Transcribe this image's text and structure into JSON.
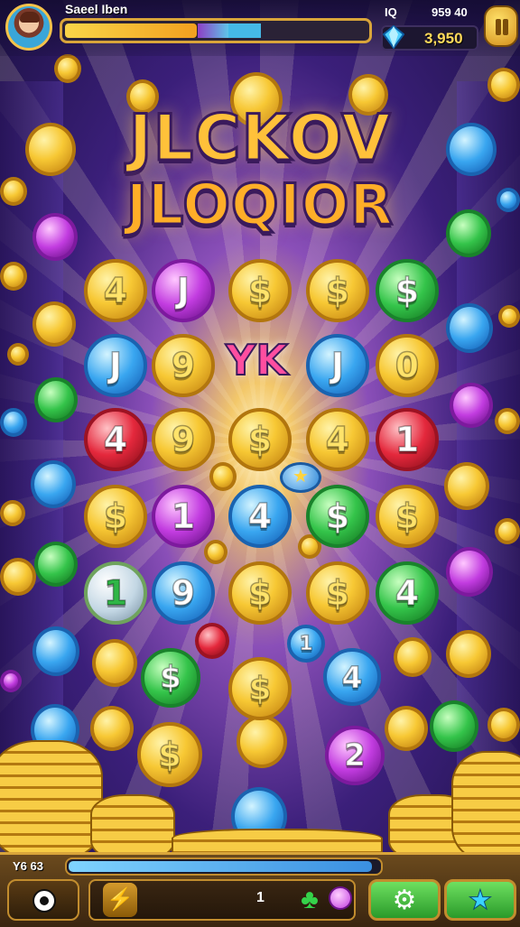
{
  "header": {
    "player_name": "Saeel Iben",
    "xp_fraction": 0.43,
    "score_label": "IQ",
    "score_value": "959 40",
    "gem_value": "3,950",
    "avatar_label": "",
    "pause_icon": "pause-icon"
  },
  "title": {
    "line1": "JLCKOV",
    "line2": "JLOQIOR"
  },
  "board": {
    "rows": [
      [
        {
          "text": "4",
          "color": "gold"
        },
        {
          "text": "J",
          "color": "purple"
        },
        {
          "text": "$",
          "color": "gold"
        },
        {
          "text": "$",
          "color": "gold"
        },
        {
          "text": "$",
          "color": "green"
        }
      ],
      [
        {
          "text": "J",
          "color": "blue"
        },
        {
          "text": "9",
          "color": "gold"
        },
        {
          "text": "",
          "color": "none"
        },
        {
          "text": "J",
          "color": "blue"
        },
        {
          "text": "0",
          "color": "gold"
        }
      ],
      [
        {
          "text": "4",
          "color": "red"
        },
        {
          "text": "9",
          "color": "gold"
        },
        {
          "text": "$",
          "color": "gold"
        },
        {
          "text": "4",
          "color": "gold"
        },
        {
          "text": "1",
          "color": "red"
        }
      ],
      [
        {
          "text": "$",
          "color": "gold"
        },
        {
          "text": "1",
          "color": "purple"
        },
        {
          "text": "4",
          "color": "blue"
        },
        {
          "text": "$",
          "color": "green"
        },
        {
          "text": "$",
          "color": "gold"
        }
      ],
      [
        {
          "text": "1",
          "color": "silver"
        },
        {
          "text": "9",
          "color": "blue"
        },
        {
          "text": "$",
          "color": "gold"
        },
        {
          "text": "$",
          "color": "gold"
        },
        {
          "text": "4",
          "color": "green"
        }
      ]
    ],
    "center_mark": "YK",
    "extra_coins": [
      {
        "text": "$",
        "color": "green"
      },
      {
        "text": "$",
        "color": "gold"
      },
      {
        "text": "1",
        "color": "blue"
      },
      {
        "text": "4",
        "color": "blue"
      },
      {
        "text": "$",
        "color": "gold"
      },
      {
        "text": "2",
        "color": "purple"
      }
    ]
  },
  "footer": {
    "level_label": "Y6 63",
    "progress_fraction": 0.97,
    "tray_count": "1",
    "icons": [
      "record-icon",
      "lightning-boost-icon",
      "clover-icon",
      "pink-gem-icon",
      "gear-icon",
      "star-icon"
    ]
  },
  "colors": {
    "gold": "#f7c834",
    "blue": "#39a6f0",
    "green": "#34c44a",
    "red": "#e4283c",
    "purple": "#c23ce0",
    "accent": "#d9a53a"
  }
}
